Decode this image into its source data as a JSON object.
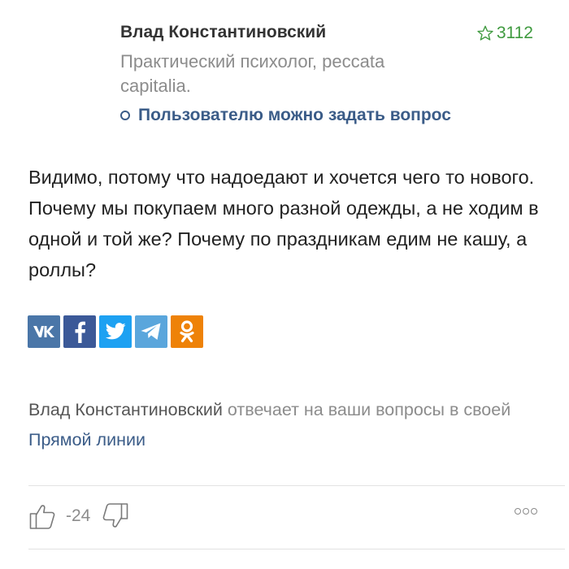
{
  "author": {
    "name": "Влад Константиновский",
    "description": "Практический психолог, peccata capitalia.",
    "ask_label": "Пользователю можно задать вопрос",
    "rating": "3112",
    "rating_icon": "star-outline-icon"
  },
  "answer": {
    "text": "Видимо, потому что надоедают и хочется чего то нового. Почему мы покупаем много разной одежды, а не ходим в одной и той же? Почему по праздникам едим не кашу, а роллы?"
  },
  "share": {
    "buttons": [
      {
        "network": "vk",
        "icon": "vk-icon",
        "color": "#4a76a8"
      },
      {
        "network": "facebook",
        "icon": "facebook-icon",
        "color": "#3b5998"
      },
      {
        "network": "twitter",
        "icon": "twitter-icon",
        "color": "#1da1f2"
      },
      {
        "network": "telegram",
        "icon": "telegram-icon",
        "color": "#5aa6dc"
      },
      {
        "network": "odnoklassniki",
        "icon": "odnoklassniki-icon",
        "color": "#ee8208"
      }
    ]
  },
  "promo": {
    "name": "Влад Константиновский",
    "text_middle": " отвечает на ваши вопросы в своей ",
    "link": "Прямой линии"
  },
  "votes": {
    "count": "-24",
    "like_icon": "thumbs-up-icon",
    "dislike_icon": "thumbs-down-icon",
    "more_icon": "more-dots-icon"
  },
  "colors": {
    "link": "#3b5c88",
    "rating": "#3f9a3f",
    "muted": "#8c8c8c"
  }
}
